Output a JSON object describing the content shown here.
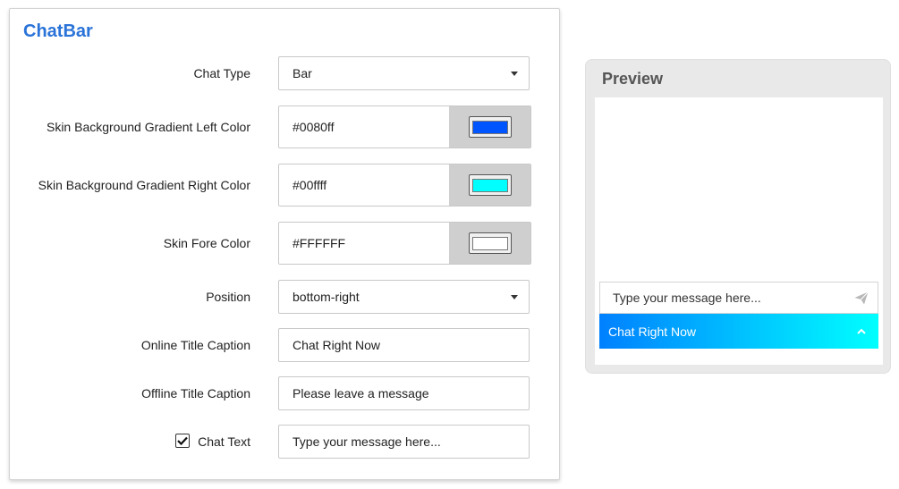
{
  "panel": {
    "title": "ChatBar"
  },
  "form": {
    "chat_type": {
      "label": "Chat Type",
      "value": "Bar"
    },
    "left_color": {
      "label": "Skin Background Gradient Left Color",
      "value": "#0080ff",
      "swatch": "#0055ff"
    },
    "right_color": {
      "label": "Skin Background Gradient Right Color",
      "value": "#00ffff",
      "swatch": "#00ffff"
    },
    "fore_color": {
      "label": "Skin Fore Color",
      "value": "#FFFFFF",
      "swatch": "#ffffff"
    },
    "position": {
      "label": "Position",
      "value": "bottom-right"
    },
    "online_title": {
      "label": "Online Title Caption",
      "value": "Chat Right Now"
    },
    "offline_title": {
      "label": "Offline Title Caption",
      "value": "Please leave a message"
    },
    "chat_text": {
      "label": "Chat Text",
      "checked": true,
      "value": "Type your message here..."
    }
  },
  "preview": {
    "title": "Preview",
    "input_placeholder": "Type your message here...",
    "bar_caption": "Chat Right Now",
    "gradient_left": "#0080ff",
    "gradient_right": "#00ffff",
    "icons": {
      "send": "send-icon",
      "collapse": "chevron-up-icon"
    }
  }
}
